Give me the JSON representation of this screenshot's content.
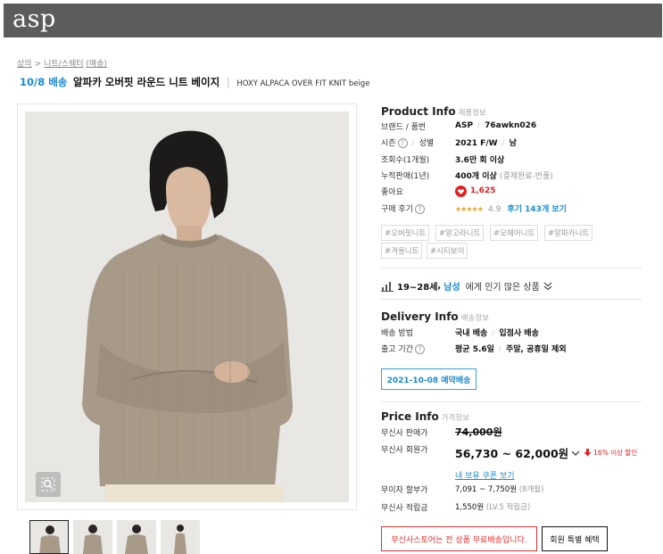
{
  "header": {
    "logo": "asp"
  },
  "breadcrumb": {
    "items": [
      "상의",
      "니트/스웨터",
      "(매송)"
    ],
    "separator": ">"
  },
  "title": {
    "delivery": "10/8 배송",
    "name": "알파카 오버핏 라운드 니트 베이지",
    "divider": "|",
    "english": "HOXY ALPACA OVER FIT KNIT beige"
  },
  "product_info": {
    "title": "Product Info",
    "subtitle": "제품정보",
    "brand_label": "브랜드 / 품번",
    "brand": "ASP",
    "code": "76awkn026",
    "season_label": "시즌",
    "gender_label": "성별",
    "season": "2021 F/W",
    "gender": "남",
    "views_label": "조회수(1개월)",
    "views": "3.6만 회 이상",
    "sales_label": "누적판매(1년)",
    "sales": "400개 이상",
    "sales_note": "(결제완료-반품)",
    "likes_label": "좋아요",
    "likes": "1,625",
    "review_label": "구매 후기",
    "stars": "★★★★★",
    "rating": "4.9",
    "review_link": "후기 143개 보기",
    "tags": [
      "#오버핏니트",
      "#알고라니트",
      "#모헤어니트",
      "#알파카니트",
      "#겨울니트",
      "#시티보이"
    ],
    "question_mark": "?",
    "slash": "/"
  },
  "popular": {
    "age": "19~28세",
    "comma": ",",
    "gender": "남성",
    "text": "에게 인기 많은 상품"
  },
  "delivery_info": {
    "title": "Delivery Info",
    "subtitle": "배송정보",
    "method_label": "배송 방법",
    "method": "국내 배송",
    "method2": "입점사 배송",
    "ship_label": "출고 기간",
    "ship": "평균 5.6일",
    "ship2": "주말, 공휴일 제외",
    "date_button": "2021-10-08 예약배송"
  },
  "price_info": {
    "title": "Price Info",
    "subtitle": "가격정보",
    "retail_label": "무신사 판매가",
    "retail": "74,000원",
    "member_label": "무신사 회원가",
    "member": "56,730 ~ 62,000원",
    "discount": "16% 이상 할인",
    "coupon_link": "내 보유 쿠폰 보기",
    "installment_label": "무이자 할부가",
    "installment": "7,091 ~ 7,750원",
    "installment_note": "(8개월)",
    "points_label": "무신사 적립금",
    "points": "1,550원",
    "points_note": "(LV.5 적립금)",
    "free_ship_button": "무신사스토어는 전 상품 무료배송입니다.",
    "member_benefit_button": "회원 특별 혜택"
  },
  "colors": {
    "accent_blue": "#1a8ad1",
    "red": "#e02020",
    "header_bg": "#5c5c5c",
    "sweater": "#a89a88"
  },
  "icons": {
    "zoom": "magnifier-icon",
    "heart": "heart-icon",
    "chart": "bar-chart-icon",
    "chevron": "double-chevron-down-icon",
    "arrow": "red-down-arrow-icon"
  }
}
